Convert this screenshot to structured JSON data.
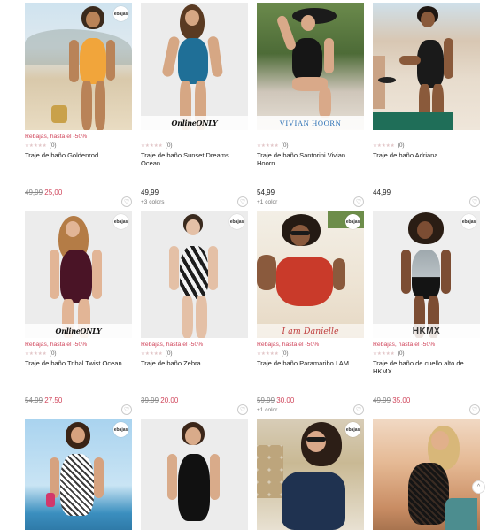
{
  "badge_text": "ebajas",
  "heart_icon": "♡",
  "star_icon": "★★★★★",
  "row1": [
    {
      "promo": "Rebajas, hasta el -50%",
      "reviews": "(0)",
      "name": "Traje de baño Goldenrod",
      "old_price": "49,99",
      "new_price": "25,00",
      "colors": ""
    },
    {
      "promo": "",
      "reviews": "(0)",
      "name": "Traje de baño Sunset Dreams Ocean",
      "old_price": "",
      "price": "49,99",
      "colors": "+3 colors",
      "brand": "OnlineONLY"
    },
    {
      "promo": "",
      "reviews": "(0)",
      "name": "Traje de baño Santorini Vivian Hoorn",
      "old_price": "",
      "price": "54,99",
      "colors": "+1 color",
      "brand": "VIVIAN HOORN"
    },
    {
      "promo": "",
      "reviews": "(0)",
      "name": "Traje de baño Adriana",
      "old_price": "",
      "price": "44,99",
      "colors": ""
    }
  ],
  "row2": [
    {
      "promo": "Rebajas, hasta el -50%",
      "reviews": "(0)",
      "name": "Traje de baño Tribal Twist Ocean",
      "old_price": "54,99",
      "new_price": "27,50",
      "colors": "",
      "brand": "OnlineONLY"
    },
    {
      "promo": "Rebajas, hasta el -50%",
      "reviews": "(0)",
      "name": "Traje de baño Zebra",
      "old_price": "39,99",
      "new_price": "20,00",
      "colors": ""
    },
    {
      "promo": "Rebajas, hasta el -50%",
      "reviews": "(0)",
      "name": "Traje de baño Paramaribo I AM",
      "old_price": "59,99",
      "new_price": "30,00",
      "colors": "+1 color",
      "brand": "I am Danielle"
    },
    {
      "promo": "Rebajas, hasta el -50%",
      "reviews": "(0)",
      "name": "Traje de baño de cuello alto de HKMX",
      "old_price": "49,99",
      "new_price": "35,00",
      "colors": "",
      "brand": "HKMX"
    }
  ],
  "scroll_top_icon": "^"
}
